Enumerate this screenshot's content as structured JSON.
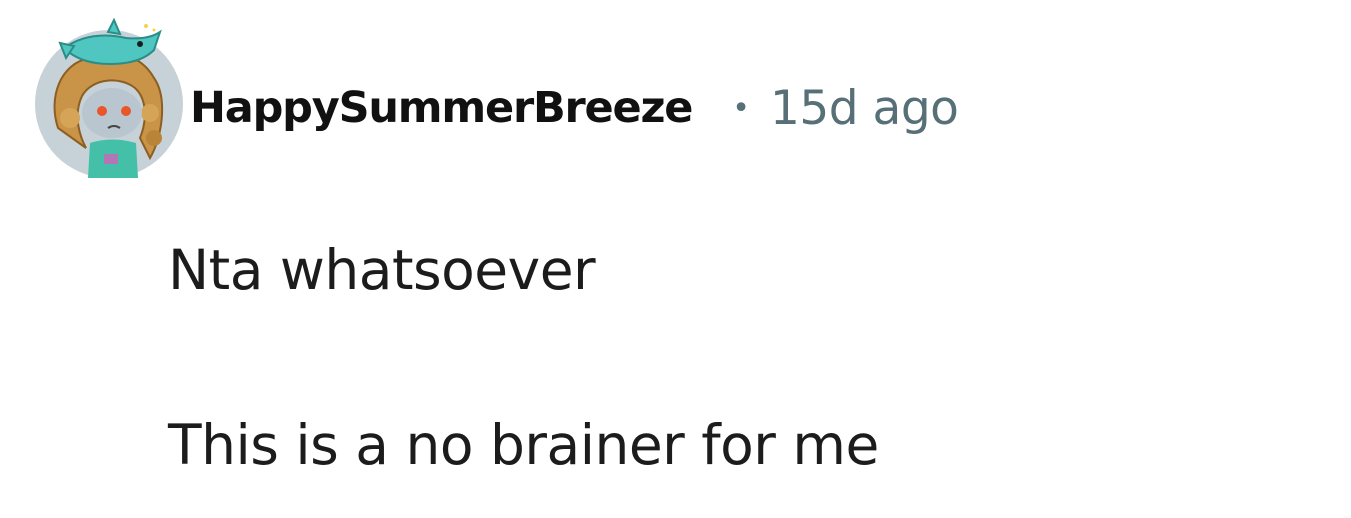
{
  "comment": {
    "author": "HappySummerBreeze",
    "separator": "•",
    "timestamp": "15d ago",
    "avatar_icon": "snoo-avatar-icon",
    "paragraphs": [
      "Nta whatsoever",
      "This is a no brainer for me"
    ]
  },
  "colors": {
    "author_text": "#111111",
    "meta_text": "#576f76",
    "body_text": "#1c1c1c",
    "avatar_bg": "#c7d2d8",
    "avatar_hair": "#c99447",
    "avatar_shark": "#4fc7c0"
  }
}
